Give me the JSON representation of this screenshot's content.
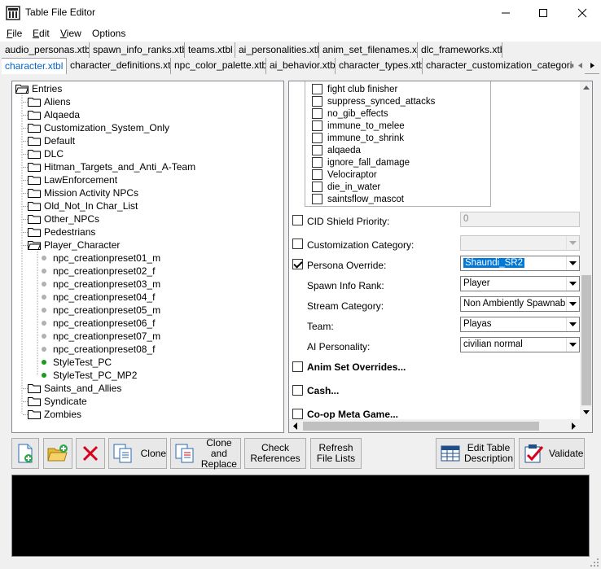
{
  "window": {
    "title": "Table File Editor",
    "minimize": "—",
    "maximize": "☐",
    "close": "✕"
  },
  "menu": [
    {
      "u": "F",
      "rest": "ile"
    },
    {
      "u": "E",
      "rest": "dit"
    },
    {
      "u": "V",
      "rest": "iew"
    },
    {
      "u": "",
      "rest": "Options"
    }
  ],
  "tabs_row1": [
    "audio_personas.xtbl",
    "spawn_info_ranks.xtbl",
    "teams.xtbl",
    "ai_personalities.xtbl",
    "anim_set_filenames.xtbl",
    "dlc_frameworks.xtbl"
  ],
  "tabs_row2": [
    "character.xtbl",
    "character_definitions.xtbl",
    "npc_color_palette.xtbl",
    "ai_behavior.xtbl",
    "character_types.xtbl",
    "character_customization_categories.xtbl"
  ],
  "tree": {
    "root": "Entries",
    "folders_top": [
      "Aliens",
      "Alqaeda",
      "Customization_System_Only",
      "Default",
      "DLC",
      "Hitman_Targets_and_Anti_A-Team",
      "LawEnforcement",
      "Mission Activity NPCs",
      "Old_Not_In Char_List",
      "Other_NPCs",
      "Pedestrians",
      "Player_Character"
    ],
    "children": [
      {
        "label": "npc_creationpreset01_m",
        "status": "gray"
      },
      {
        "label": "npc_creationpreset02_f",
        "status": "gray"
      },
      {
        "label": "npc_creationpreset03_m",
        "status": "gray"
      },
      {
        "label": "npc_creationpreset04_f",
        "status": "gray"
      },
      {
        "label": "npc_creationpreset05_m",
        "status": "gray"
      },
      {
        "label": "npc_creationpreset06_f",
        "status": "gray"
      },
      {
        "label": "npc_creationpreset07_m",
        "status": "gray"
      },
      {
        "label": "npc_creationpreset08_f",
        "status": "gray"
      },
      {
        "label": "StyleTest_PC",
        "status": "green"
      },
      {
        "label": "StyleTest_PC_MP2",
        "status": "green"
      }
    ],
    "folders_bottom": [
      "Saints_and_Allies",
      "Syndicate",
      "Zombies"
    ]
  },
  "flags": [
    "fight club finisher",
    "suppress_synced_attacks",
    "no_gib_effects",
    "immune_to_melee",
    "immune_to_shrink",
    "alqaeda",
    "ignore_fall_damage",
    "Velociraptor",
    "die_in_water",
    "saintsflow_mascot"
  ],
  "props": {
    "cid_shield": {
      "label": "CID Shield Priority:",
      "value": "0"
    },
    "custom_cat": {
      "label": "Customization Category:",
      "value": ""
    },
    "persona": {
      "label": "Persona Override:",
      "value": "Shaundi_SR2"
    },
    "spawn_rank": {
      "label": "Spawn Info Rank:",
      "value": "Player"
    },
    "stream_cat": {
      "label": "Stream Category:",
      "value": "Non Ambiently Spawnable"
    },
    "team": {
      "label": "Team:",
      "value": "Playas"
    },
    "ai_personality": {
      "label": "AI Personality:",
      "value": "civilian normal"
    },
    "anim_sets": "Anim Set Overrides...",
    "cash": "Cash...",
    "coop": "Co-op Meta Game..."
  },
  "toolbar": {
    "clone": "Clone",
    "clone_replace_1": "Clone and",
    "clone_replace_2": "Replace",
    "check_refs_1": "Check",
    "check_refs_2": "References",
    "refresh_1": "Refresh",
    "refresh_2": "File Lists",
    "edit_desc_1": "Edit Table",
    "edit_desc_2": "Description",
    "validate": "Validate"
  },
  "colors": {
    "accent": "#0066cc",
    "selection": "#0078d7",
    "green_dot": "#1a9e1a",
    "gray_dot": "#b0b0b0",
    "delete_red": "#d9001b"
  }
}
